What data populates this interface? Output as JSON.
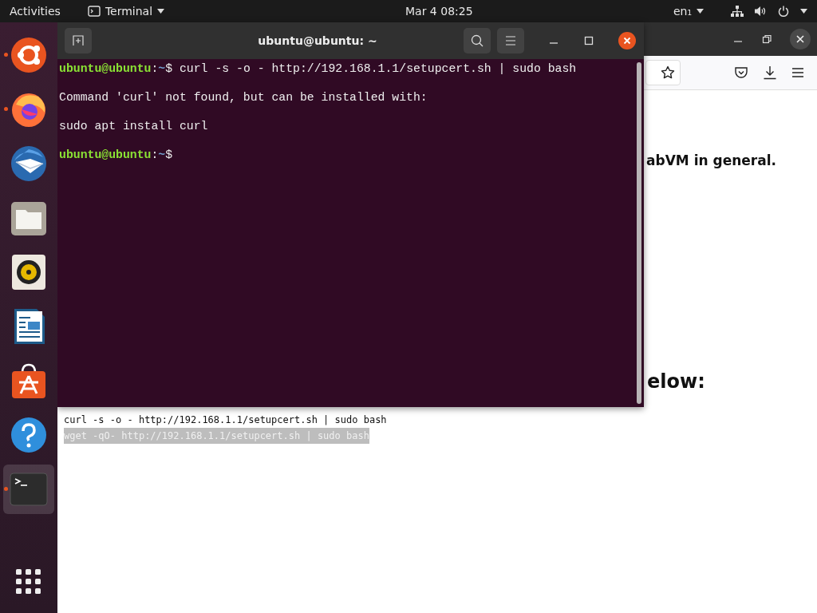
{
  "top_bar": {
    "activities": "Activities",
    "app_menu": "Terminal",
    "clock": "Mar 4  08:25",
    "input_source": "en₁"
  },
  "dock": {
    "items": [
      {
        "running": true,
        "focused": false
      },
      {
        "running": true,
        "focused": false
      },
      {
        "running": false,
        "focused": false
      },
      {
        "running": false,
        "focused": false
      },
      {
        "running": false,
        "focused": false
      },
      {
        "running": false,
        "focused": false
      },
      {
        "running": false,
        "focused": false
      },
      {
        "running": false,
        "focused": false
      },
      {
        "running": true,
        "focused": true
      }
    ]
  },
  "browser": {
    "page": {
      "heading_1": "abVM in general.",
      "heading_2": "elow:",
      "code_lines": [
        {
          "text": "curl -s -o - http://192.168.1.1/setupcert.sh | sudo bash",
          "selected": false
        },
        {
          "text": "wget -qO- http://192.168.1.1/setupcert.sh | sudo bash",
          "selected": true
        }
      ]
    }
  },
  "terminal": {
    "title": "ubuntu@ubuntu: ~",
    "lines": [
      {
        "kind": "prompt",
        "user": "ubuntu@ubuntu",
        "separator": ":",
        "path": "~",
        "symbol": "$",
        "command": "curl -s -o - http://192.168.1.1/setupcert.sh | sudo bash"
      },
      {
        "kind": "output",
        "text": "Command 'curl' not found, but can be installed with:"
      },
      {
        "kind": "output",
        "text": "sudo apt install curl"
      },
      {
        "kind": "prompt",
        "user": "ubuntu@ubuntu",
        "separator": ":",
        "path": "~",
        "symbol": "$"
      }
    ]
  }
}
